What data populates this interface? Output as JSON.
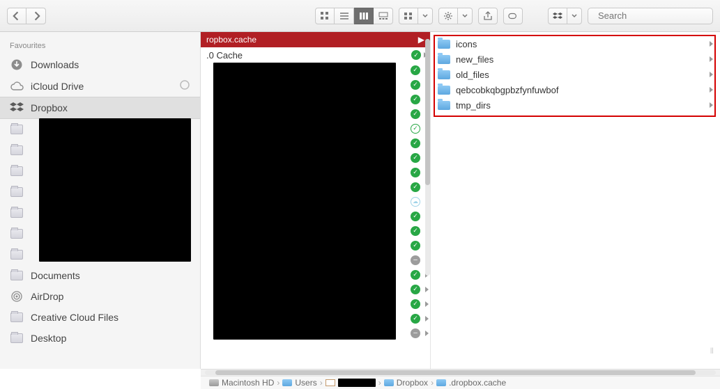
{
  "toolbar": {
    "search_placeholder": "Search"
  },
  "sidebar": {
    "section": "Favourites",
    "items": [
      {
        "label": "Downloads",
        "icon": "download"
      },
      {
        "label": "iCloud Drive",
        "icon": "cloud",
        "aux": "progress"
      },
      {
        "label": "Dropbox",
        "icon": "dropbox",
        "selected": true
      },
      {
        "label": "",
        "icon": "folder",
        "redacted": true
      },
      {
        "label": "",
        "icon": "folder"
      },
      {
        "label": "",
        "icon": "folder"
      },
      {
        "label": "",
        "icon": "folder"
      },
      {
        "label": "",
        "icon": "folder"
      },
      {
        "label": "",
        "icon": "folder"
      },
      {
        "label": "",
        "icon": "folder"
      },
      {
        "label": "Documents",
        "icon": "folder"
      },
      {
        "label": "AirDrop",
        "icon": "airdrop"
      },
      {
        "label": "Creative Cloud Files",
        "icon": "folder"
      },
      {
        "label": "Desktop",
        "icon": "folder"
      }
    ]
  },
  "column1": {
    "header_label": "ropbox.cache",
    "first_row_label": ".0 Cache",
    "rows": [
      {
        "badge": "green",
        "arrow": true
      },
      {
        "badge": "green",
        "arrow": true
      },
      {
        "badge": "green",
        "arrow": true
      },
      {
        "badge": "green",
        "arrow": true
      },
      {
        "badge": "green-outline",
        "arrow": true
      },
      {
        "badge": "green",
        "arrow": true
      },
      {
        "badge": "green",
        "arrow": true
      },
      {
        "badge": "green",
        "arrow": true
      },
      {
        "badge": "green",
        "arrow": true
      },
      {
        "badge": "cloud",
        "arrow": true
      },
      {
        "badge": "green",
        "arrow": true
      },
      {
        "badge": "green",
        "arrow": true
      },
      {
        "badge": "green",
        "arrow": true
      },
      {
        "badge": "grey",
        "arrow": true
      },
      {
        "badge": "green",
        "arrow": true
      },
      {
        "badge": "green",
        "arrow": true
      },
      {
        "badge": "green",
        "arrow": true
      },
      {
        "badge": "green",
        "arrow": true
      },
      {
        "badge": "grey",
        "arrow": true
      }
    ]
  },
  "column2": {
    "items": [
      {
        "label": "icons"
      },
      {
        "label": "new_files"
      },
      {
        "label": "old_files"
      },
      {
        "label": "qebcobkqbgpbzfynfuwbof"
      },
      {
        "label": "tmp_dirs"
      }
    ]
  },
  "pathbar": {
    "segments": [
      {
        "label": "Macintosh HD",
        "icon": "hd"
      },
      {
        "label": "Users",
        "icon": "bl"
      },
      {
        "label": "",
        "icon": "hm",
        "redacted": true
      },
      {
        "label": "Dropbox",
        "icon": "bl"
      },
      {
        "label": ".dropbox.cache",
        "icon": "bl"
      }
    ]
  }
}
